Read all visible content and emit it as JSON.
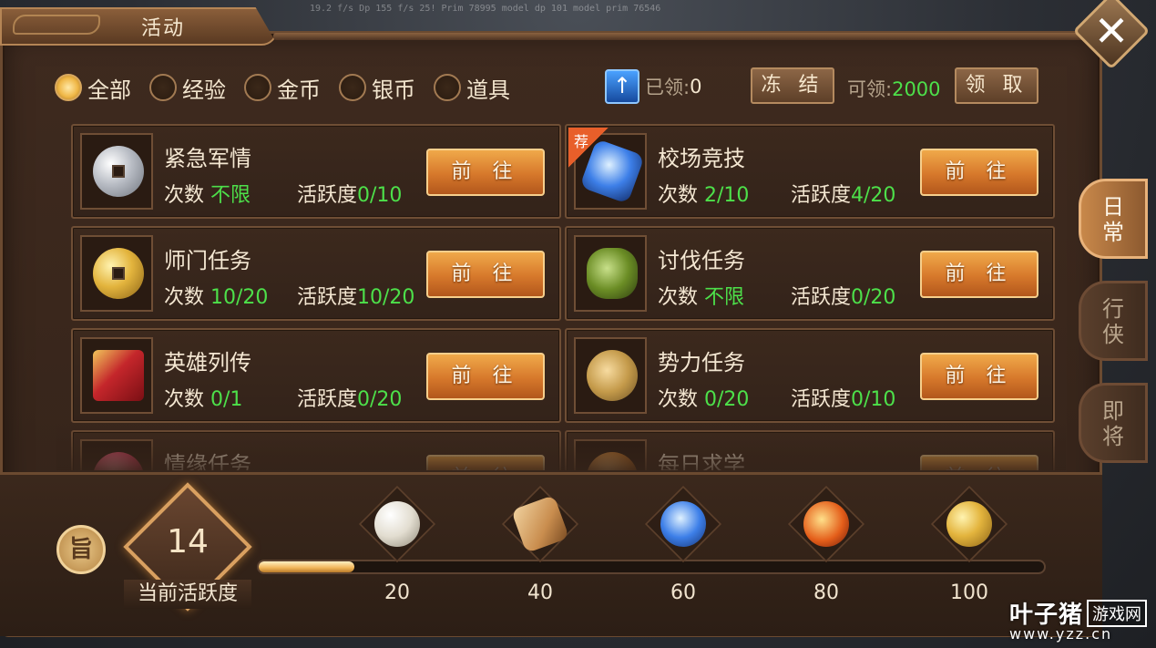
{
  "debug": "19.2 f/s  Dp 155 f/s 25! Prim 78995 model dp 101 model prim 76546",
  "title": "活动",
  "close": "✕",
  "filters": [
    {
      "label": "全部",
      "selected": true
    },
    {
      "label": "经验",
      "selected": false
    },
    {
      "label": "金币",
      "selected": false
    },
    {
      "label": "银币",
      "selected": false
    },
    {
      "label": "道具",
      "selected": false
    }
  ],
  "claimed": {
    "label": "已领:",
    "value": "0"
  },
  "freeze_label": "冻 结",
  "claimable": {
    "label": "可领:",
    "value": "2000"
  },
  "claim_label": "领 取",
  "count_prefix": "次数 ",
  "active_prefix": "活跃度",
  "go_label": "前 往",
  "recommend_tag": "荐",
  "tasks": [
    {
      "name": "紧急军情",
      "count": "不限",
      "active": "0/10",
      "icon": "silver-coin-icon"
    },
    {
      "name": "校场竞技",
      "count": "2/10",
      "active": "4/20",
      "icon": "blue-crystal-icon",
      "recommended": true
    },
    {
      "name": "师门任务",
      "count": "10/20",
      "active": "10/20",
      "icon": "gold-coin-icon"
    },
    {
      "name": "讨伐任务",
      "count": "不限",
      "active": "0/20",
      "icon": "dragon-ring-icon"
    },
    {
      "name": "英雄列传",
      "count": "0/1",
      "active": "0/20",
      "icon": "red-book-icon"
    },
    {
      "name": "势力任务",
      "count": "0/20",
      "active": "0/10",
      "icon": "bronze-medal-icon"
    },
    {
      "name": "情缘任务",
      "count": "",
      "active": "",
      "icon": "rose-icon"
    },
    {
      "name": "每日求学",
      "count": "",
      "active": "",
      "icon": "orange-orb-icon"
    }
  ],
  "side_tabs": [
    {
      "label": "日常",
      "active": true
    },
    {
      "label": "行侠",
      "active": false
    },
    {
      "label": "即将",
      "active": false
    }
  ],
  "calendar_icon": "calendar-icon",
  "calendar_glyph": "旨",
  "current_activity": {
    "value": "14",
    "label": "当前活跃度",
    "max": 100
  },
  "milestones": [
    {
      "value": "20",
      "icon": "pearl-icon"
    },
    {
      "value": "40",
      "icon": "scroll-icon"
    },
    {
      "value": "60",
      "icon": "blue-crystal-icon"
    },
    {
      "value": "80",
      "icon": "flame-orb-icon"
    },
    {
      "value": "100",
      "icon": "gold-coin-icon"
    }
  ],
  "watermark": {
    "text": "叶子猪",
    "box": "游戏网",
    "url": "www.yzz.cn"
  }
}
